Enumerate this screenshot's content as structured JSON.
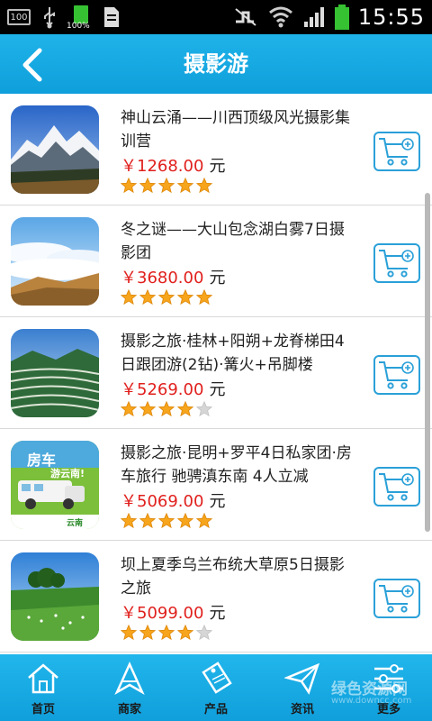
{
  "status_bar": {
    "indicator": "100",
    "battery_percent": "100%",
    "time": "15:55",
    "icons": [
      "storage-full-icon",
      "usb-icon",
      "battery-icon",
      "document-icon",
      "mute-icon",
      "wifi-icon",
      "signal-icon",
      "battery-status-icon"
    ]
  },
  "header": {
    "title": "摄影游",
    "back_icon": "chevron-left-icon"
  },
  "colors": {
    "header": "#1fb3e9",
    "price": "#e0201d",
    "cart_border": "#2aa0d8",
    "star_filled": "#f7a51c",
    "star_empty": "#d6d6d6"
  },
  "products": [
    {
      "title": "神山云涌——川西顶级风光摄影集训营",
      "price": "￥1268.00",
      "unit": "元",
      "rating": 5,
      "image": "snow-mountain-photo"
    },
    {
      "title": "冬之谜——大山包念湖白雾7日摄影团",
      "price": "￥3680.00",
      "unit": "元",
      "rating": 5,
      "image": "sea-of-clouds-photo"
    },
    {
      "title": "摄影之旅·桂林+阳朔+龙脊梯田4日跟团游(2钻)·篝火+吊脚楼",
      "price": "￥5269.00",
      "unit": "元",
      "rating": 4,
      "image": "rice-terraces-photo"
    },
    {
      "title": "摄影之旅·昆明+罗平4日私家团·房车旅行 驰骋滇东南 4人立减",
      "price": "￥5069.00",
      "unit": "元",
      "rating": 5,
      "image": "rv-travel-poster",
      "image_text": {
        "headline": "房车",
        "sub": "游云南!",
        "footer": "云南"
      }
    },
    {
      "title": "坝上夏季乌兰布统大草原5日摄影之旅",
      "price": "￥5099.00",
      "unit": "元",
      "rating": 4,
      "image": "grassland-photo"
    }
  ],
  "bottom_nav": [
    {
      "label": "首页",
      "icon": "home-icon"
    },
    {
      "label": "商家",
      "icon": "merchant-icon"
    },
    {
      "label": "产品",
      "icon": "sale-tag-icon"
    },
    {
      "label": "资讯",
      "icon": "paper-plane-icon"
    },
    {
      "label": "更多",
      "icon": "settings-sliders-icon"
    }
  ],
  "watermark": {
    "text": "绿色资源网",
    "sub": "www.downcc.com"
  }
}
